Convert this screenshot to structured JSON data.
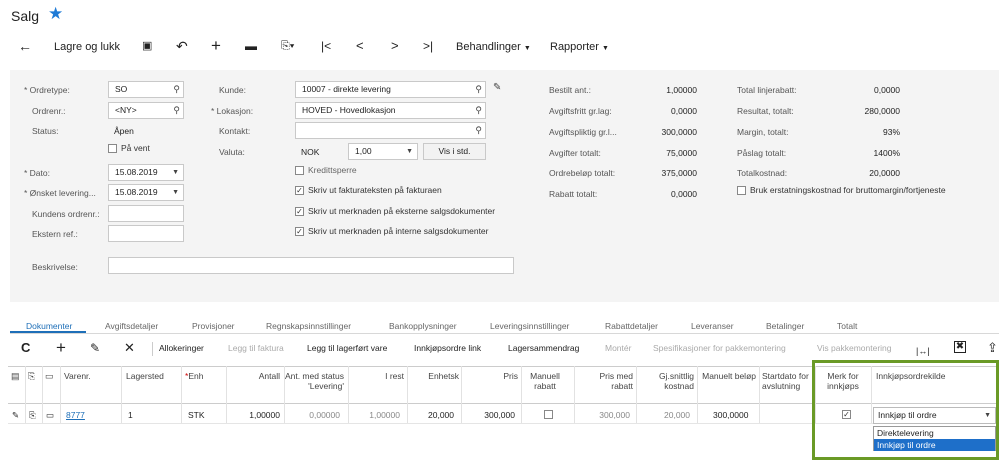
{
  "header": {
    "title": "Salg",
    "favorite_icon": "star-icon"
  },
  "toolbar": {
    "back_icon": "←",
    "save_close_label": "Lagre og lukk",
    "save_icon": "💾",
    "undo_icon": "↶",
    "add_icon": "+",
    "delete_icon": "🗑",
    "copy_icon": "⎘▾",
    "first_icon": "|<",
    "prev_icon": "<",
    "next_icon": ">",
    "last_icon": ">|",
    "actions_label": "Behandlinger",
    "reports_label": "Rapporter"
  },
  "form": {
    "ordertype_label": "Ordretype:",
    "ordertype_value": "SO",
    "ordernr_label": "Ordrenr.:",
    "ordernr_value": "<NY>",
    "status_label": "Status:",
    "status_value": "Åpen",
    "on_hold_label": "På vent",
    "date_label": "Dato:",
    "date_value": "15.08.2019",
    "requested_label": "Ønsket levering...",
    "requested_value": "15.08.2019",
    "customer_order_label": "Kundens ordrenr.:",
    "external_ref_label": "Ekstern ref.:",
    "description_label": "Beskrivelse:",
    "customer_label": "Kunde:",
    "customer_value": "10007 - direkte levering",
    "location_label": "Lokasjon:",
    "location_value": "HOVED - Hovedlokasjon",
    "contact_label": "Kontakt:",
    "currency_label": "Valuta:",
    "currency_value": "NOK",
    "rate_value": "1,00",
    "view_base_label": "Vis i std.",
    "credit_hold_label": "Kredittsperre",
    "print_invoice_label": "Skriv ut fakturateksten på fakturaen",
    "print_external_label": "Skriv ut merknaden på eksterne salgsdokumenter",
    "print_internal_label": "Skriv ut merknaden på interne salgsdokumenter"
  },
  "summary": {
    "ordered_qty_label": "Bestilt ant.:",
    "ordered_qty_value": "1,00000",
    "taxfree_label": "Avgiftsfritt gr.lag:",
    "taxfree_value": "0,0000",
    "taxable_label": "Avgiftspliktig gr.l...",
    "taxable_value": "300,0000",
    "tax_total_label": "Avgifter totalt:",
    "tax_total_value": "75,0000",
    "order_total_label": "Ordrebeløp totalt:",
    "order_total_value": "375,0000",
    "discount_total_label": "Rabatt totalt:",
    "discount_total_value": "0,0000",
    "line_discount_label": "Total linjerabatt:",
    "line_discount_value": "0,0000",
    "profit_label": "Resultat, totalt:",
    "profit_value": "280,0000",
    "margin_label": "Margin, totalt:",
    "margin_value": "93%",
    "markup_label": "Påslag totalt:",
    "markup_value": "1400%",
    "total_cost_label": "Totalkostnad:",
    "total_cost_value": "20,0000",
    "replacement_cost_label": "Bruk erstatningskostnad for bruttomargin/fortjeneste"
  },
  "tabs": [
    "Dokumenter",
    "Avgiftsdetaljer",
    "Provisjoner",
    "Regnskapsinnstillinger",
    "Bankopplysninger",
    "Leveringsinnstillinger",
    "Rabattdetaljer",
    "Leveranser",
    "Betalinger",
    "Totalt"
  ],
  "grid_toolbar": {
    "refresh_icon": "C",
    "add_icon": "+",
    "edit_icon": "✎",
    "delete_icon": "✕",
    "allocations": "Allokeringer",
    "add_invoice": "Legg til faktura",
    "add_stock": "Legg til lagerført vare",
    "po_link": "Innkjøpsordre link",
    "stock_summary": "Lagersammendrag",
    "assemble": "Montér",
    "kit_specs": "Spesifikasjoner for pakkemontering",
    "show_kit": "Vis pakkemontering",
    "fit_icon": "|↔|",
    "excel_icon": "✖",
    "upload_icon": "⇪"
  },
  "grid": {
    "columns": {
      "item": "Varenr.",
      "warehouse": "Lagersted",
      "uom": "Enh",
      "qty": "Antall",
      "shipped_qty": "Ant. med status 'Levering'",
      "remaining": "I rest",
      "unit": "Enhetsk",
      "price": "Pris",
      "manual_discount": "Manuell rabatt",
      "price_with_discount": "Pris med rabatt",
      "avg_cost": "Gj.snittlig kostnad",
      "manual_amount": "Manuelt beløp",
      "start_date": "Startdato for avslutning",
      "mark_po": "Merk for innkjøps",
      "po_source": "Innkjøpsordrekilde"
    },
    "row": {
      "item": "8777",
      "warehouse": "1",
      "uom": "STK",
      "qty": "1,00000",
      "shipped_qty": "0,00000",
      "remaining": "1,00000",
      "unit": "20,000",
      "price": "300,000",
      "price_with_discount": "300,000",
      "avg_cost": "20,000",
      "manual_amount": "300,0000",
      "po_source": "Innkjøp til ordre"
    },
    "po_source_options": [
      "Direktelevering",
      "Innkjøp til ordre"
    ]
  },
  "colors": {
    "accent": "#1e6fb8",
    "highlight": "#6a9a26",
    "selected_option": "#1e6fc9"
  }
}
